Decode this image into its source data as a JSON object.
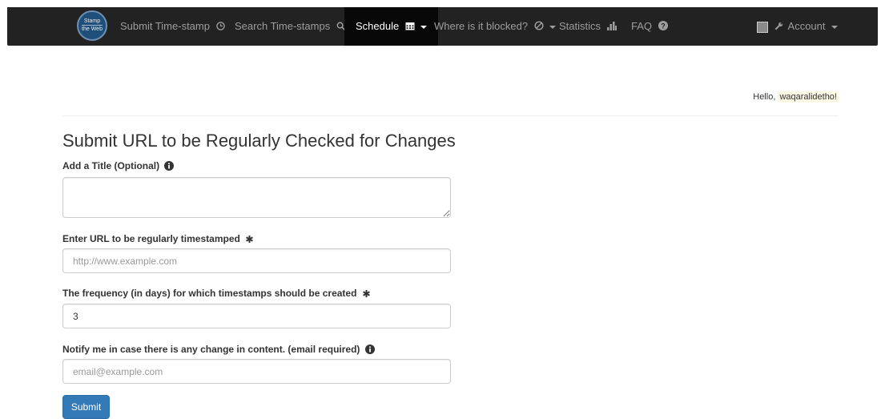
{
  "nav": {
    "logo_line1": "Stamp",
    "logo_line2": "the Web",
    "items": [
      {
        "label": "Submit Time-stamp"
      },
      {
        "label": "Search Time-stamps"
      },
      {
        "label": "Schedule"
      },
      {
        "label": "Where is it blocked?"
      },
      {
        "label": "Statistics"
      },
      {
        "label": "FAQ"
      }
    ],
    "account_label": "Account"
  },
  "greeting": {
    "prefix": "Hello, ",
    "username": "waqaralidetho!"
  },
  "form": {
    "title": "Submit URL to be Regularly Checked for Changes",
    "title_label": "Add a Title (Optional)",
    "title_value": "",
    "url_label": "Enter URL to be regularly timestamped",
    "url_placeholder": "http://www.example.com",
    "frequency_label": "The frequency (in days) for which timestamps should be created",
    "frequency_value": "3",
    "notify_label": "Notify me in case there is any change in content. (email required)",
    "email_placeholder": "email@example.com",
    "submit_label": "Submit"
  },
  "colors": {
    "navbar": "#222222",
    "primary": "#337ab7",
    "highlight": "#fcf8e3"
  }
}
